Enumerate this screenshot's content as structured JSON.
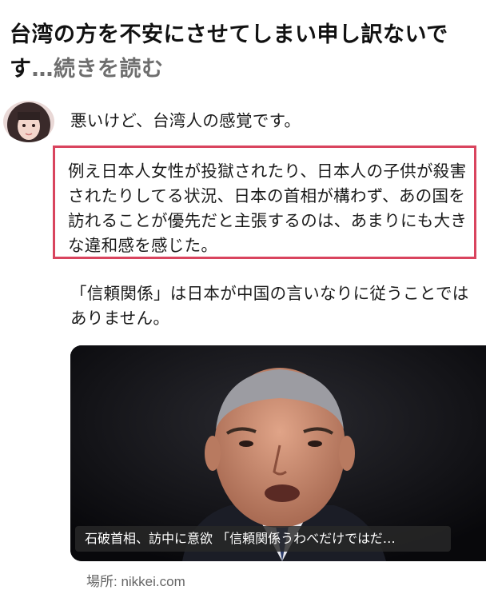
{
  "headline": {
    "text": "台湾の方を不安にさせてしまい申し訳ないです",
    "read_more": "…続きを読む"
  },
  "post": {
    "line1": "悪いけど、台湾人の感覚です。",
    "highlight": "例え日本人女性が投獄されたり、日本人の子供が殺害されたりしてる状況、日本の首相が構わず、あの国を訪れることが優先だと主張するのは、あまりにも大きな違和感を感じた。",
    "line3": "「信頼関係」は日本が中国の言いなりに従うことではありません。"
  },
  "card": {
    "caption": "石破首相、訪中に意欲 「信頼関係うわべだけではだ…",
    "source": "場所: nikkei.com"
  },
  "colors": {
    "highlight_border": "#d9445e",
    "muted_text": "#6e6e6e"
  }
}
